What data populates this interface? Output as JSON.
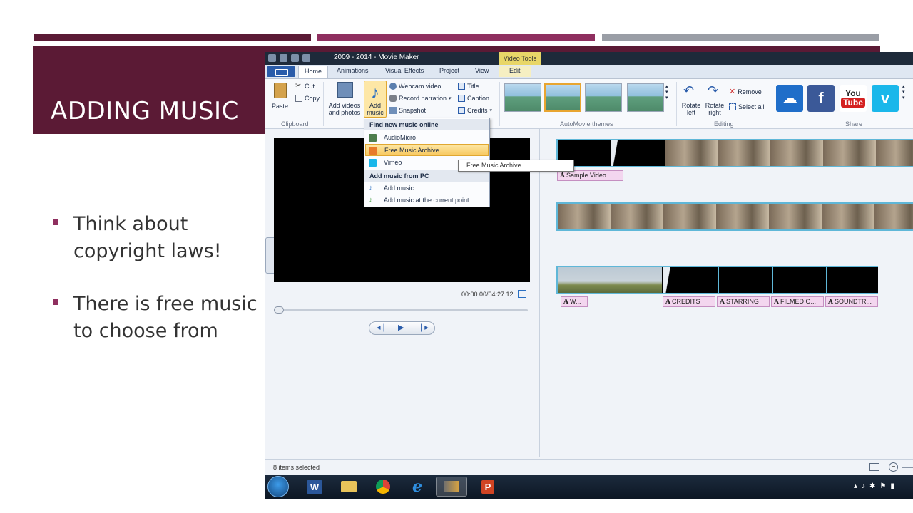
{
  "slide": {
    "title": "ADDING MUSIC",
    "bullets": [
      "Think about copyright laws!",
      "There is free music to choose from"
    ],
    "colors": {
      "band": "#5b1a35",
      "accent": "#8f2f5f",
      "gray": "#9a9ea6"
    }
  },
  "app": {
    "window_title": "2009 - 2014 - Movie Maker",
    "contextual_tab": "Video Tools",
    "tabs": [
      "Home",
      "Animations",
      "Visual Effects",
      "Project",
      "View",
      "Edit"
    ],
    "ribbon": {
      "paste": "Paste",
      "cut": "Cut",
      "copy": "Copy",
      "clipboard_group": "Clipboard",
      "add_videos": [
        "Add videos",
        "and photos"
      ],
      "add_music": [
        "Add",
        "music"
      ],
      "webcam": "Webcam video",
      "narration": "Record narration",
      "snapshot": "Snapshot",
      "title": "Title",
      "caption": "Caption",
      "credits": "Credits",
      "themes_group": "AutoMovie themes",
      "rotate_left": [
        "Rotate",
        "left"
      ],
      "rotate_right": [
        "Rotate",
        "right"
      ],
      "remove": "Remove",
      "select_all": "Select all",
      "editing_group": "Editing",
      "share_group": "Share",
      "youtube": [
        "You",
        "Tube"
      ]
    },
    "menu": {
      "online_header": "Find new music online",
      "online_items": [
        "AudioMicro",
        "Free Music Archive",
        "Vimeo"
      ],
      "pc_header": "Add music from PC",
      "pc_items": [
        "Add music...",
        "Add music at the current point..."
      ],
      "tooltip": "Free Music Archive"
    },
    "player": {
      "timecode": "00:00.00/04:27.12"
    },
    "captions": {
      "row1": "Sample Video",
      "row3": [
        "W...",
        "CREDITS",
        "STARRING",
        "FILMED O...",
        "SOUNDTR..."
      ]
    },
    "status": "8 items selected",
    "taskbar_letters": {
      "word": "W",
      "powerpoint": "P"
    }
  }
}
